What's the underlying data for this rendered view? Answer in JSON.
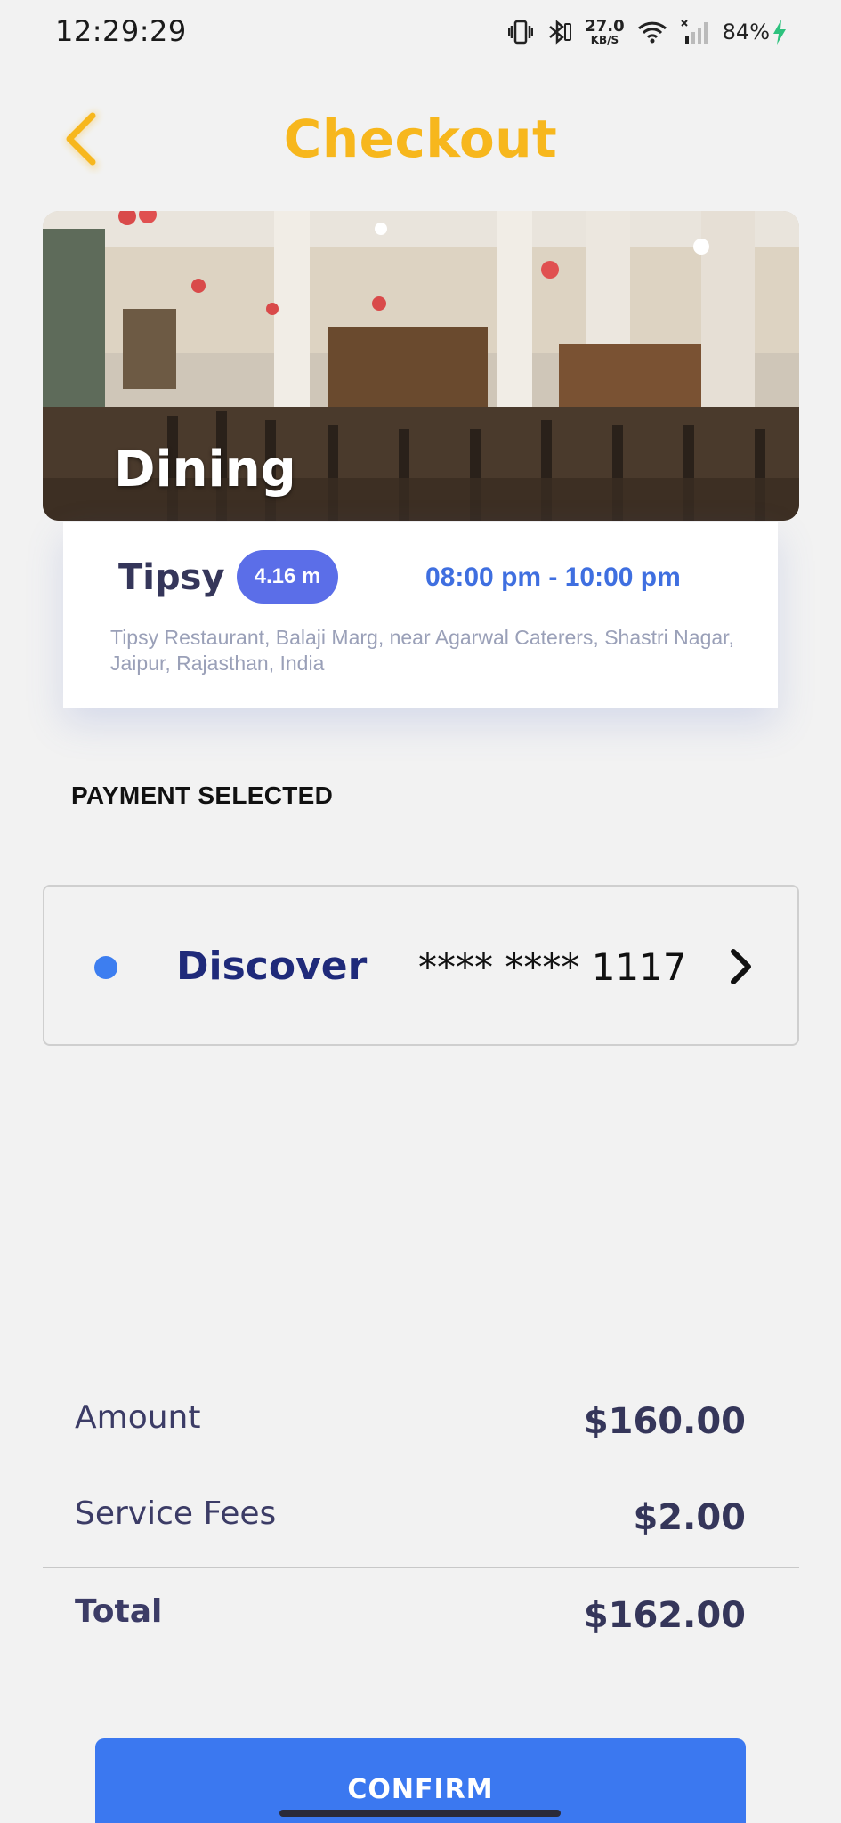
{
  "status_bar": {
    "time": "12:29:29",
    "net_speed_value": "27.0",
    "net_speed_unit": "KB/S",
    "battery": "84%",
    "icons": [
      "vibrate-icon",
      "bluetooth-icon",
      "wifi-icon",
      "cell-signal-icon",
      "charging-icon"
    ]
  },
  "header": {
    "title": "Checkout",
    "back_icon": "chevron-left-icon",
    "accent_color": "#f7b71d"
  },
  "hero": {
    "label": "Dining"
  },
  "restaurant": {
    "name": "Tipsy",
    "distance": "4.16 m",
    "time_range": "08:00 pm - 10:00 pm",
    "address": "Tipsy Restaurant, Balaji Marg, near Agarwal Caterers, Shastri Nagar, Jaipur, Rajasthan, India"
  },
  "payment": {
    "section_title": "PAYMENT SELECTED",
    "card_brand": "Discover",
    "card_number": "**** **** 1117",
    "chevron_icon": "chevron-right-icon"
  },
  "summary": {
    "amount_label": "Amount",
    "amount_value": "$160.00",
    "fees_label": "Service Fees",
    "fees_value": "$2.00",
    "total_label": "Total",
    "total_value": "$162.00"
  },
  "actions": {
    "confirm_label": "CONFIRM",
    "confirm_color": "#3b78f0"
  }
}
